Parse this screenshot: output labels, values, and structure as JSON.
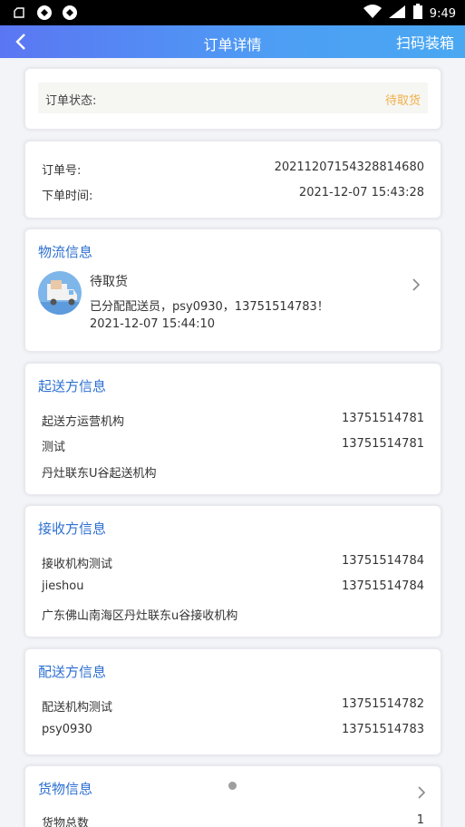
{
  "statusbar": {
    "time": "9:49"
  },
  "nav": {
    "title": "订单详情",
    "action": "扫码装箱"
  },
  "order_status": {
    "label": "订单状态:",
    "value": "待取货"
  },
  "order_info": {
    "number_label": "订单号:",
    "number": "20211207154328814680",
    "time_label": "下单时间:",
    "time": "2021-12-07 15:43:28"
  },
  "logistics": {
    "title": "物流信息",
    "status": "待取货",
    "desc": "已分配配送员，psy0930，13751514783！",
    "time": "2021-12-07 15:44:10"
  },
  "sender": {
    "title": "起送方信息",
    "org": "起送方运营机构",
    "org_phone": "13751514781",
    "contact": "测试",
    "contact_phone": "13751514781",
    "address": "丹灶联东U谷起送机构"
  },
  "receiver": {
    "title": "接收方信息",
    "org": "接收机构测试",
    "org_phone": "13751514784",
    "contact": "jieshou",
    "contact_phone": "13751514784",
    "address": "广东佛山南海区丹灶联东u谷接收机构"
  },
  "delivery": {
    "title": "配送方信息",
    "org": "配送机构测试",
    "org_phone": "13751514782",
    "courier": "psy0930",
    "courier_phone": "13751514783"
  },
  "goods": {
    "title": "货物信息",
    "total_label": "货物总数",
    "total": "1"
  },
  "colors": {
    "accent": "#2c6fd1",
    "pending": "#f0b04a",
    "nav_start": "#5b76f3",
    "nav_end": "#4aa8f2"
  }
}
